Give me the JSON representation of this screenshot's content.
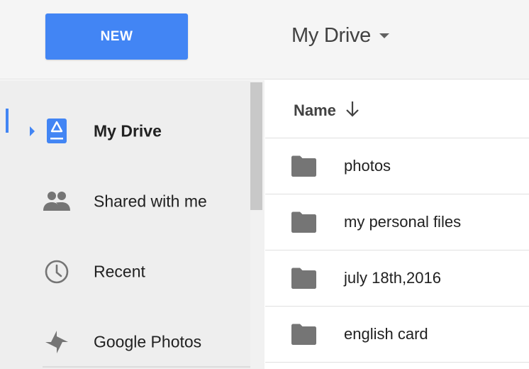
{
  "header": {
    "new_label": "NEW",
    "drive_title": "My Drive"
  },
  "sidebar": {
    "items": [
      {
        "label": "My Drive",
        "icon": "my-drive-icon",
        "active": true
      },
      {
        "label": "Shared with me",
        "icon": "shared-people-icon",
        "active": false
      },
      {
        "label": "Recent",
        "icon": "clock-icon",
        "active": false
      },
      {
        "label": "Google Photos",
        "icon": "pinwheel-icon",
        "active": false
      }
    ]
  },
  "list": {
    "header_name": "Name",
    "sort_direction": "descending",
    "files": [
      {
        "name": "photos",
        "type": "folder"
      },
      {
        "name": "my personal files",
        "type": "folder"
      },
      {
        "name": "july 18th,2016",
        "type": "folder"
      },
      {
        "name": "english card",
        "type": "folder"
      }
    ]
  },
  "colors": {
    "accent": "#4285f4",
    "folder": "#757575",
    "sidebar_bg": "#eeeeee",
    "topbar_bg": "#f5f5f5"
  }
}
